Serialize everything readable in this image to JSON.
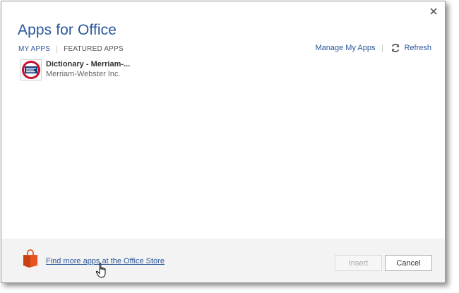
{
  "dialog": {
    "title": "Apps for Office"
  },
  "tabs": [
    {
      "label": "MY APPS",
      "active": true
    },
    {
      "label": "FEATURED APPS",
      "active": false
    }
  ],
  "actions": {
    "manage_label": "Manage My Apps",
    "refresh_label": "Refresh"
  },
  "apps": [
    {
      "name": "Dictionary - Merriam-...",
      "publisher": "Merriam-Webster Inc."
    }
  ],
  "footer": {
    "store_link": "Find more apps at the Office Store",
    "insert_label": "Insert",
    "cancel_label": "Cancel"
  },
  "icons": {
    "close": "close-icon",
    "refresh": "refresh-icon",
    "app_logo": "merriam-webster-logo-icon",
    "store": "office-store-bag-icon",
    "cursor": "hand-cursor-icon"
  },
  "colors": {
    "accent": "#2b579a",
    "store_orange": "#e8531f",
    "logo_red": "#c8102e",
    "logo_blue": "#0f3a7d",
    "footer_bg": "#f3f3f3"
  }
}
